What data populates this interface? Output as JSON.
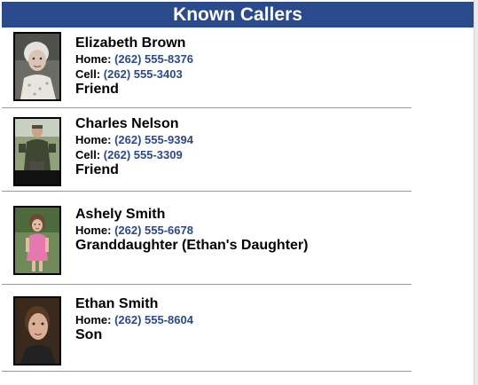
{
  "header": {
    "title": "Known Callers"
  },
  "colors": {
    "header_bg": "#2b4a8b",
    "header_text": "#ffffff",
    "phone_link": "#2b4a8b"
  },
  "callers": [
    {
      "name": "Elizabeth Brown",
      "phones": [
        {
          "label": "Home:",
          "number": "(262) 555-8376"
        },
        {
          "label": "Cell:",
          "number": "(262) 555-3403"
        }
      ],
      "relation": "Friend",
      "photo": "elderly-woman-portrait"
    },
    {
      "name": "Charles Nelson",
      "phones": [
        {
          "label": "Home:",
          "number": "(262) 555-9394"
        },
        {
          "label": "Cell:",
          "number": "(262) 555-3309"
        }
      ],
      "relation": "Friend",
      "photo": "man-outdoors-portrait"
    },
    {
      "name": "Ashely Smith",
      "phones": [
        {
          "label": "Home:",
          "number": "(262) 555-6678"
        }
      ],
      "relation": "Granddaughter (Ethan's Daughter)",
      "photo": "girl-pink-dress-portrait"
    },
    {
      "name": "Ethan Smith",
      "phones": [
        {
          "label": "Home:",
          "number": "(262) 555-8604"
        }
      ],
      "relation": "Son",
      "photo": "young-man-portrait"
    }
  ]
}
